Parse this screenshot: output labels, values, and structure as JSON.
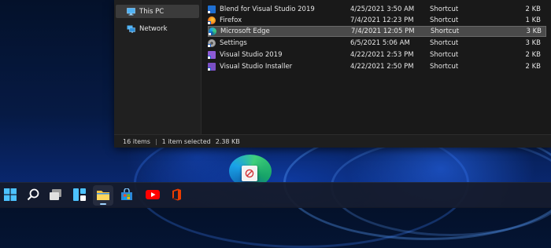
{
  "sidebar": {
    "items": [
      {
        "label": "This PC",
        "icon": "monitor-icon",
        "selected": true
      },
      {
        "label": "Network",
        "icon": "network-icon",
        "selected": false
      }
    ]
  },
  "files": [
    {
      "name": "Blend for Visual Studio 2019",
      "date": "4/25/2021 3:50 AM",
      "type": "Shortcut",
      "size": "2 KB",
      "icon": "blend-icon",
      "color": "#1f6fd1",
      "selected": false
    },
    {
      "name": "Firefox",
      "date": "7/4/2021 12:23 PM",
      "type": "Shortcut",
      "size": "1 KB",
      "icon": "firefox-icon",
      "color": "#f27a1a",
      "selected": false
    },
    {
      "name": "Microsoft Edge",
      "date": "7/4/2021 12:05 PM",
      "type": "Shortcut",
      "size": "3 KB",
      "icon": "edge-icon",
      "color": "#1aa2e8",
      "selected": true
    },
    {
      "name": "Settings",
      "date": "6/5/2021 5:06 AM",
      "type": "Shortcut",
      "size": "3 KB",
      "icon": "settings-icon",
      "color": "#8a8a8a",
      "selected": false
    },
    {
      "name": "Visual Studio 2019",
      "date": "4/22/2021 2:53 PM",
      "type": "Shortcut",
      "size": "2 KB",
      "icon": "visual-studio-icon",
      "color": "#8d5bd6",
      "selected": false
    },
    {
      "name": "Visual Studio Installer",
      "date": "4/22/2021 2:50 PM",
      "type": "Shortcut",
      "size": "2 KB",
      "icon": "visual-studio-installer-icon",
      "color": "#7a4fc4",
      "selected": false
    }
  ],
  "status": {
    "item_count": "16 items",
    "selection": "1 item selected",
    "selection_size": "2.38 KB"
  },
  "taskbar": {
    "items": [
      {
        "name": "start",
        "icon": "windows-start-icon"
      },
      {
        "name": "search",
        "icon": "search-icon"
      },
      {
        "name": "task-view",
        "icon": "task-view-icon"
      },
      {
        "name": "widgets",
        "icon": "widgets-icon"
      },
      {
        "name": "file-explorer",
        "icon": "folder-icon",
        "active": true
      },
      {
        "name": "microsoft-store",
        "icon": "store-icon"
      },
      {
        "name": "youtube",
        "icon": "youtube-icon"
      },
      {
        "name": "office",
        "icon": "office-icon"
      }
    ]
  },
  "drag": {
    "icon": "edge-icon",
    "cursor": "no-drop-icon"
  },
  "colors": {
    "selection_bg": "#4a4a4a",
    "window_bg": "#191919",
    "accent": "#1aa2e8"
  }
}
